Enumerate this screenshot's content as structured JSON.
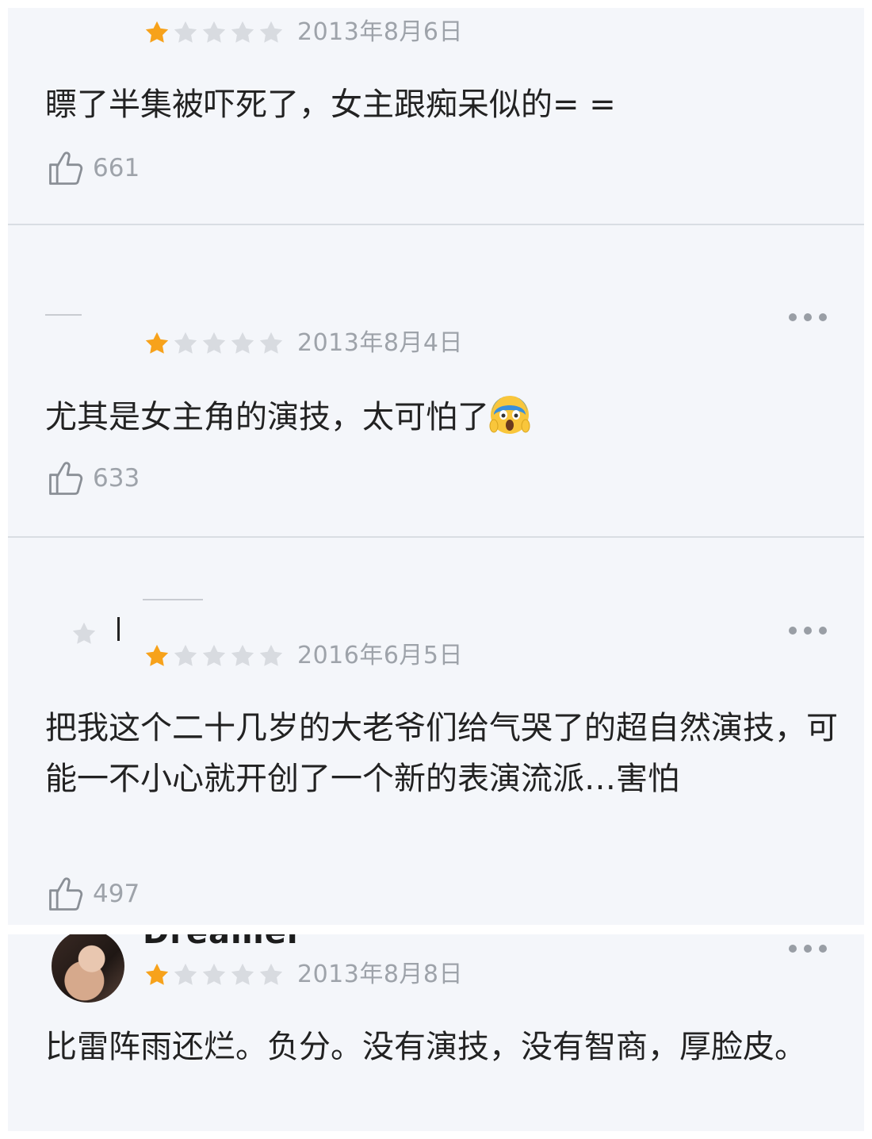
{
  "colors": {
    "star_filled": "#f7a21b",
    "star_empty": "#d8dbe0",
    "meta_gray": "#9ea3aa",
    "card_bg": "#f4f6fa",
    "text": "#222222"
  },
  "reviews": [
    {
      "rating": 1,
      "date": "2013年8月6日",
      "text": "瞟了半集被吓死了，女主跟痴呆似的= =",
      "likes": "661"
    },
    {
      "rating": 1,
      "date": "2013年8月4日",
      "text": "尤其是女主角的演技，太可怕了",
      "emoji": "screaming-face-icon",
      "likes": "633"
    },
    {
      "rating": 1,
      "date": "2016年6月5日",
      "text": "把我这个二十几岁的大老爷们给气哭了的超自然演技，可能一不小心就开创了一个新的表演流派…害怕",
      "likes": "497"
    },
    {
      "username": "Dreamer",
      "rating": 1,
      "date": "2013年8月8日",
      "text": "比雷阵雨还烂。负分。没有演技，没有智商，厚脸皮。"
    }
  ]
}
